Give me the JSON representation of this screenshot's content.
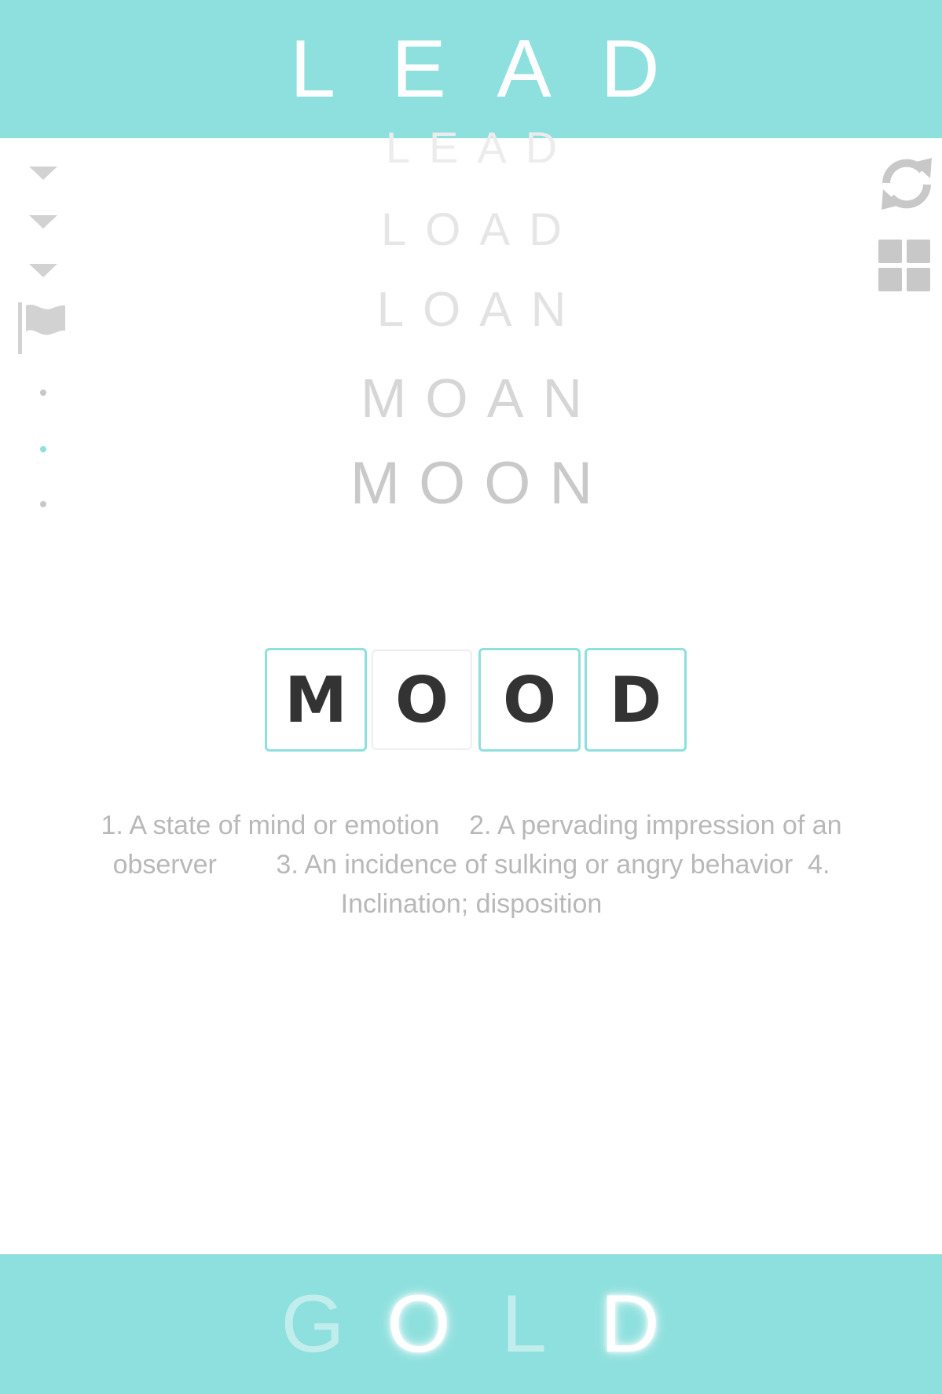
{
  "start_word": {
    "letters": [
      "L",
      "E",
      "A",
      "D"
    ]
  },
  "history": [
    {
      "word": [
        "L",
        "E",
        "A",
        "D"
      ]
    },
    {
      "word": [
        "L",
        "O",
        "A",
        "D"
      ]
    },
    {
      "word": [
        "L",
        "O",
        "A",
        "N"
      ]
    },
    {
      "word": [
        "M",
        "O",
        "A",
        "N"
      ]
    },
    {
      "word": [
        "M",
        "O",
        "O",
        "N"
      ]
    }
  ],
  "current_word": {
    "letters": [
      "M",
      "O",
      "O",
      "D"
    ],
    "active": [
      true,
      false,
      true,
      true
    ]
  },
  "definition": "1. A state of mind or emotion    2. A pervading impression of an observer        3. An incidence of sulking or angry behavior  4. Inclination; disposition",
  "target_word": {
    "letters": [
      "G",
      "O",
      "L",
      "D"
    ],
    "matched": [
      false,
      true,
      false,
      true
    ]
  },
  "icons": {
    "refresh": "refresh-icon",
    "grid": "grid-icon",
    "flag": "flag-icon",
    "arrow": "chevron-down-icon"
  },
  "colors": {
    "accent": "#8ee0de",
    "tile_text": "#333333",
    "muted": "#b8b8b8"
  }
}
